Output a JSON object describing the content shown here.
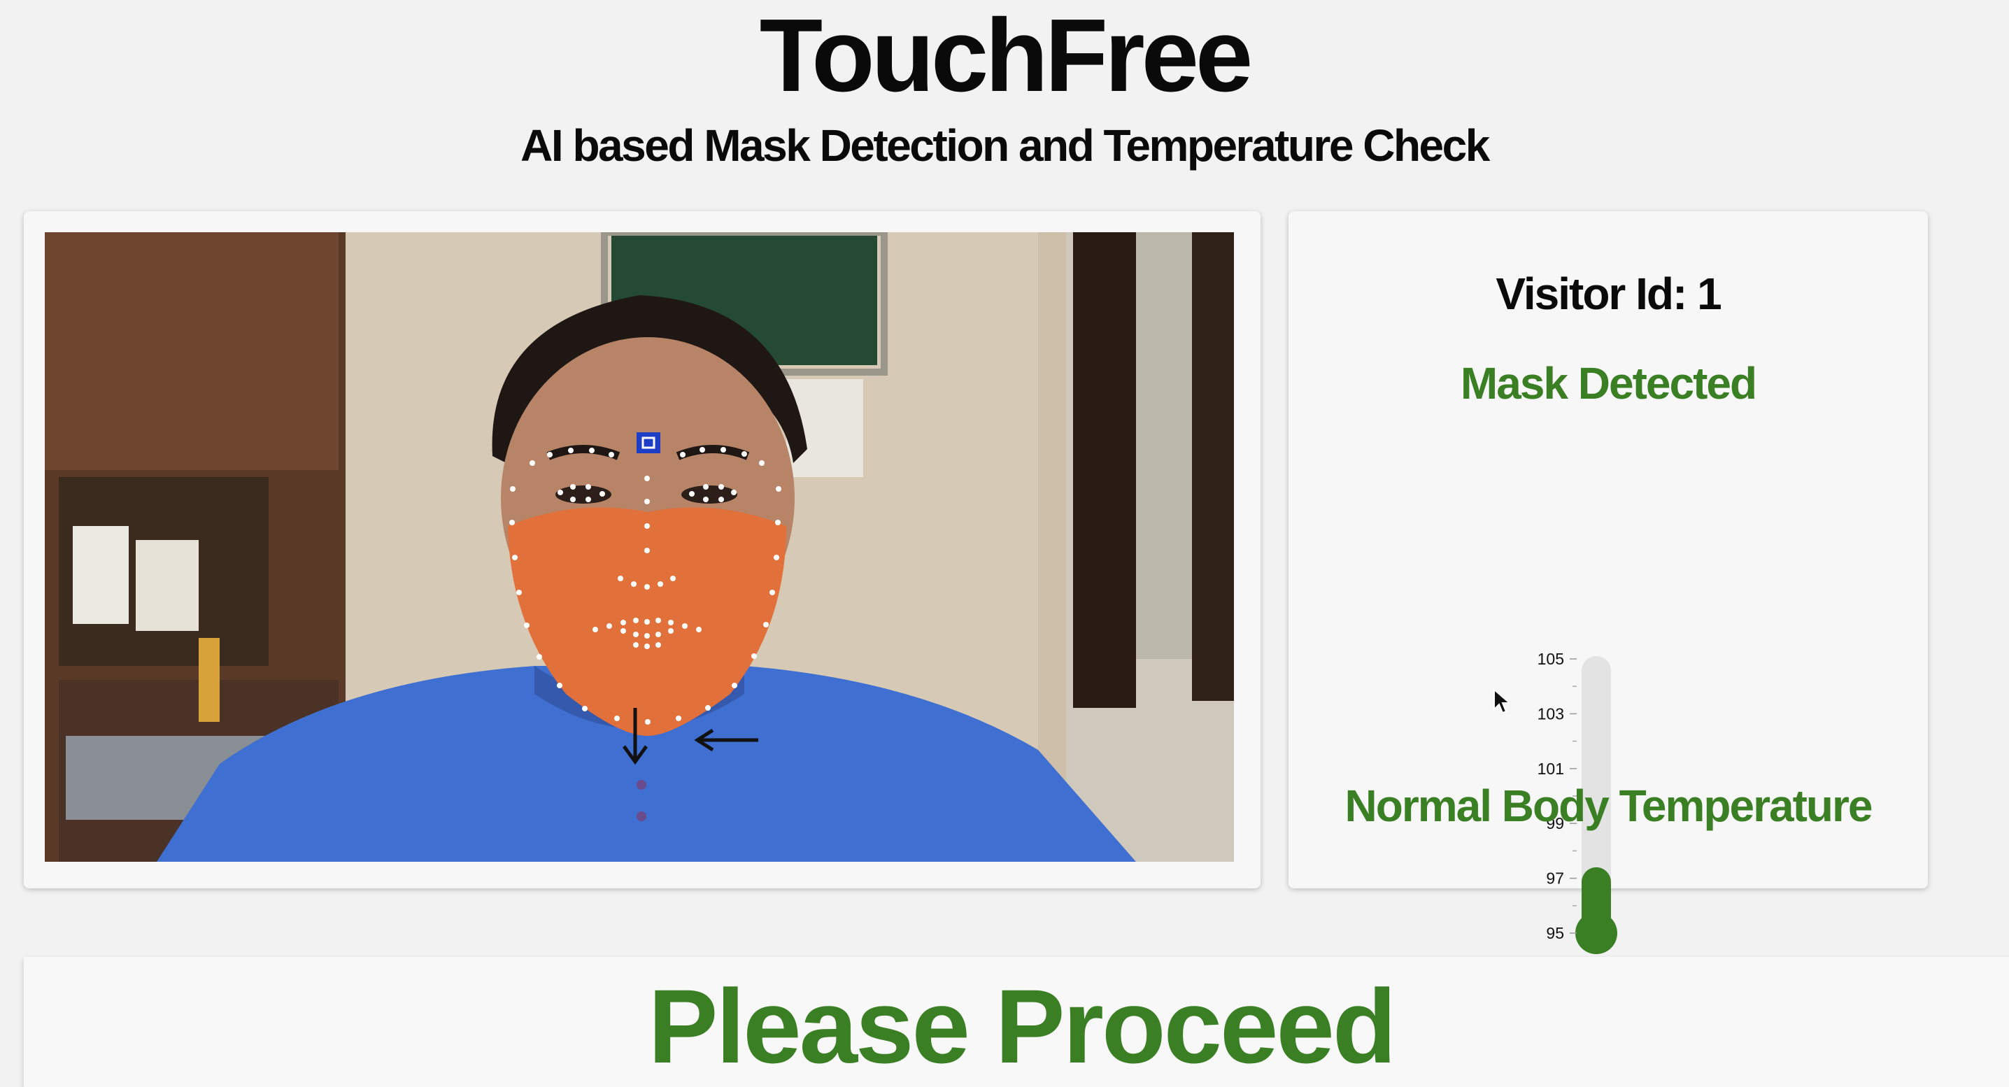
{
  "header": {
    "title": "TouchFree",
    "subtitle": "AI based Mask Detection and Temperature Check"
  },
  "status_panel": {
    "visitor_id": "Visitor Id: 1",
    "mask_status": "Mask Detected",
    "temperature_status": "Normal Body Temperature",
    "status_color": "#3a7f23"
  },
  "thermometer": {
    "tick_labels": [
      "105",
      "103",
      "101",
      "99",
      "97",
      "95"
    ],
    "min": 95,
    "max": 105,
    "level": 97.4,
    "fill_color": "#3a7f23",
    "track_color": "#e3e3e3"
  },
  "footer": {
    "message": "Please Proceed"
  },
  "camera": {
    "content": "webcam frame with face landmarks",
    "shirt_color": "#3f6fd0",
    "mask_color": "#e2703a",
    "landmark_color": "#ffffff",
    "marker_color": "#1f3ec8"
  },
  "icons": {
    "cursor": "mouse-pointer-icon",
    "down_arrow": "arrow-down-icon",
    "left_arrow": "arrow-left-icon",
    "marker": "target-square-icon"
  }
}
